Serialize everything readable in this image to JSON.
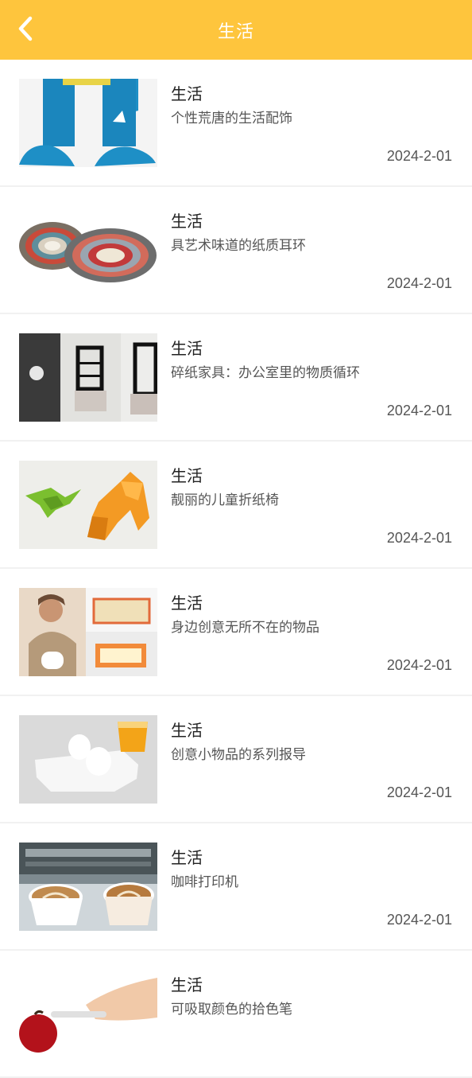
{
  "header": {
    "title": "生活",
    "back_icon": "chevron-left-icon",
    "background": "#FEC53D"
  },
  "items": [
    {
      "category": "生活",
      "title": "个性荒唐的生活配饰",
      "date": "2024-2-01"
    },
    {
      "category": "生活",
      "title": "具艺术味道的纸质耳环",
      "date": "2024-2-01"
    },
    {
      "category": "生活",
      "title": "碎纸家具：办公室里的物质循环",
      "date": "2024-2-01"
    },
    {
      "category": "生活",
      "title": "靓丽的儿童折纸椅",
      "date": "2024-2-01"
    },
    {
      "category": "生活",
      "title": "身边创意无所不在的物品",
      "date": "2024-2-01"
    },
    {
      "category": "生活",
      "title": "创意小物品的系列报导",
      "date": "2024-2-01"
    },
    {
      "category": "生活",
      "title": "咖啡打印机",
      "date": "2024-2-01"
    },
    {
      "category": "生活",
      "title": "可吸取颜色的拾色笔",
      "date": ""
    }
  ]
}
